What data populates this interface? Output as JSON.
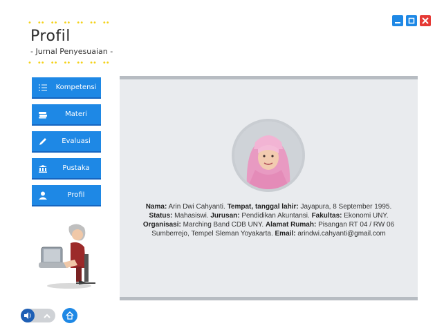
{
  "header": {
    "title": "Profil",
    "subtitle": "- Jurnal Penyesuaian -"
  },
  "menu": [
    {
      "label": "Kompetensi",
      "icon": "list-icon"
    },
    {
      "label": "Materi",
      "icon": "books-icon"
    },
    {
      "label": "Evaluasi",
      "icon": "pencil-icon"
    },
    {
      "label": "Pustaka",
      "icon": "library-icon"
    },
    {
      "label": "Profil",
      "icon": "user-icon"
    }
  ],
  "profile": {
    "nama_label": "Nama:",
    "nama": "Arin Dwi Cahyanti.",
    "ttl_label": "Tempat, tanggal lahir:",
    "ttl": "Jayapura, 8 September 1995.",
    "status_label": "Status:",
    "status": "Mahasiswi.",
    "jurusan_label": "Jurusan:",
    "jurusan": "Pendidikan Akuntansi.",
    "fakultas_label": "Fakultas:",
    "fakultas": "Ekonomi UNY.",
    "organisasi_label": "Organisasi:",
    "organisasi": "Marching Band CDB UNY.",
    "alamat_label": "Alamat Rumah:",
    "alamat": "Pisangan RT 04 / RW 06 Sumberrejo, Tempel Sleman Yoyakarta.",
    "email_label": "Email:",
    "email": "arindwi.cahyanti@gmail.com"
  },
  "colors": {
    "accent": "#1e88e5",
    "close": "#e53935",
    "dots": "#f4d21a",
    "panel": "#e9ebee"
  }
}
